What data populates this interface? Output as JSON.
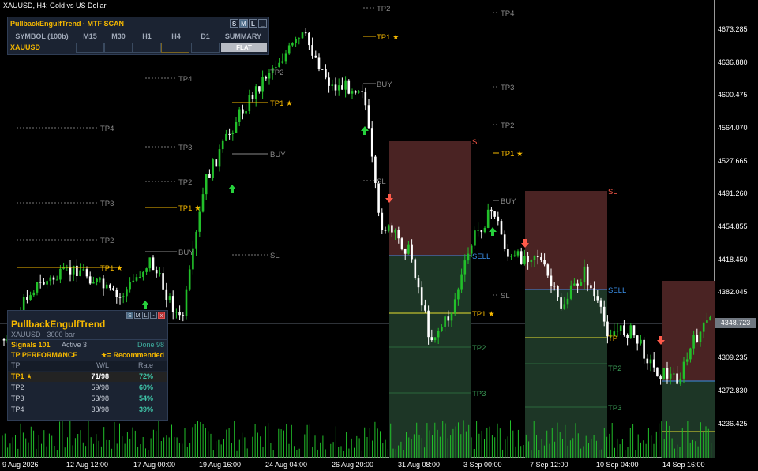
{
  "window": {
    "title": "XAUUSD, H4:  Gold vs US Dollar"
  },
  "colors": {
    "bull": "#22c02a",
    "bear": "#ffffff",
    "sl_zone": "#4a2323",
    "tp_zone": "#1d3626",
    "accent": "#f5b800",
    "sell": "#3a8ee6",
    "up_arrow": "#27d13c",
    "down_arrow": "#ff5a4a"
  },
  "price_axis": {
    "labels": [
      "4673.285",
      "4636.880",
      "4600.475",
      "4564.070",
      "4527.665",
      "4491.260",
      "4454.855",
      "4418.450",
      "4382.045",
      "4345.640",
      "4309.235",
      "4272.830",
      "4236.425"
    ],
    "current": "4348.723"
  },
  "time_axis": {
    "labels": [
      "9 Aug 2026",
      "12 Aug 12:00",
      "17 Aug 00:00",
      "19 Aug 16:00",
      "24 Aug 04:00",
      "26 Aug 20:00",
      "31 Aug 08:00",
      "3 Sep 00:00",
      "7 Sep 12:00",
      "10 Sep 04:00",
      "14 Sep 16:00"
    ]
  },
  "scanner": {
    "title": "PullbackEngulfTrend · MTF SCAN",
    "buttons": [
      "S",
      "M",
      "L",
      "_"
    ],
    "columns": [
      "SYMBOL (100b)",
      "M15",
      "M30",
      "H1",
      "H4",
      "D1",
      "SUMMARY"
    ],
    "symbol": "XAUUSD",
    "summary": "FLAT"
  },
  "stats": {
    "title": "PullbackEngulfTrend",
    "subtitle": "XAUUSD · 3000 bar",
    "buttons": [
      "S",
      "M",
      "L",
      "-",
      "x"
    ],
    "signals": "Signals 101",
    "active": "Active 3",
    "done": "Done 98",
    "perf_title": "TP PERFORMANCE",
    "recommended": "★= Recommended",
    "headers": [
      "TP",
      "W/L",
      "Rate"
    ],
    "rows": [
      {
        "tp": "TP1 ★",
        "wl": "71/98",
        "rate": "72%"
      },
      {
        "tp": "TP2",
        "wl": "59/98",
        "rate": "60%"
      },
      {
        "tp": "TP3",
        "wl": "53/98",
        "rate": "54%"
      },
      {
        "tp": "TP4",
        "wl": "38/98",
        "rate": "39%"
      }
    ]
  },
  "chart_labels": {
    "tp1": "TP1 ★",
    "tp2": "TP2",
    "tp3": "TP3",
    "tp4": "TP4",
    "buy": "BUY",
    "sell": "SELL",
    "sl": "SL",
    "tp": "TP"
  }
}
